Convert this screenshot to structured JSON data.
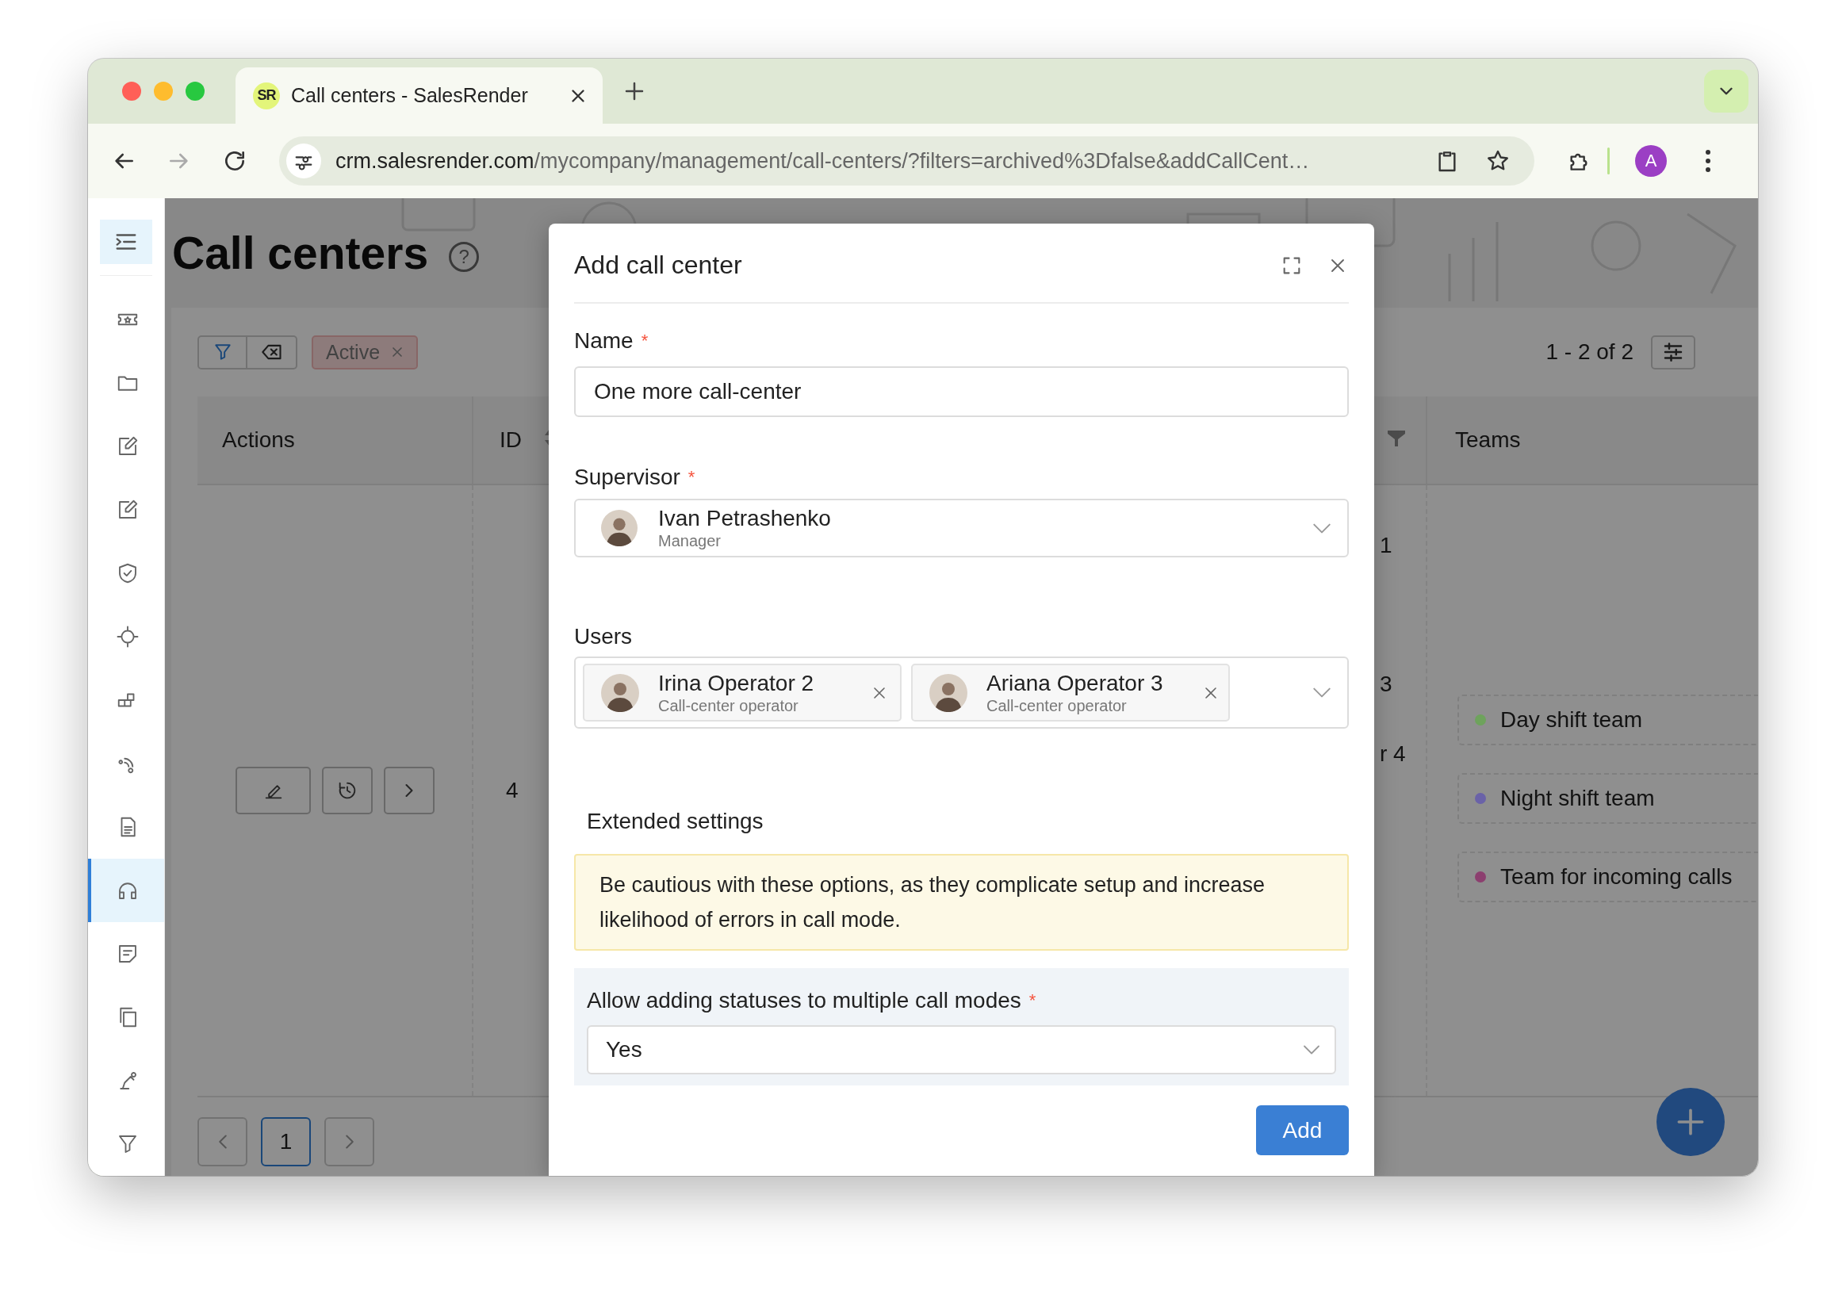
{
  "browser": {
    "tab": {
      "favicon": "SR",
      "title": "Call centers - SalesRender"
    },
    "back": {
      "disabled": false
    },
    "forward": {
      "disabled": true
    },
    "url": {
      "host": "crm.salesrender.com",
      "path": "/mycompany/management/call-centers/?filters=archived%3Dfalse&addCallCent…"
    },
    "profile": "A"
  },
  "sidebar": {
    "items": [
      {
        "selected": false
      },
      {
        "selected": false
      },
      {
        "selected": false
      },
      {
        "selected": false
      },
      {
        "selected": false
      },
      {
        "selected": false
      },
      {
        "selected": false
      },
      {
        "selected": false
      },
      {
        "selected": false
      },
      {
        "selected": true
      },
      {
        "selected": false
      },
      {
        "selected": false
      },
      {
        "selected": false
      },
      {
        "selected": false
      }
    ]
  },
  "page": {
    "title": "Call centers",
    "help": "?",
    "filters": [
      {
        "label": "Active"
      }
    ],
    "range": "1 - 2 of 2",
    "table": {
      "columns": [
        {
          "label": "Actions"
        },
        {
          "label": "ID",
          "sortable": true
        },
        {
          "filterable": true
        },
        {
          "label": "Teams"
        }
      ],
      "rows": [
        {
          "id": "4",
          "column_3": [
            "1",
            "3",
            "r 4"
          ],
          "teams": [
            {
              "name": "Day shift team",
              "color": "#6ea35c"
            },
            {
              "name": "Night shift team",
              "color": "#6a62a8"
            },
            {
              "name": "Team for incoming calls",
              "color": "#8c3f6f"
            }
          ]
        }
      ]
    },
    "pagination": [
      {
        "label": "1",
        "selected": true
      }
    ]
  },
  "modal": {
    "title": "Add call center",
    "name_field": {
      "label": "Name",
      "marker": "*",
      "value": "One more call-center"
    },
    "supervisor_field": {
      "label": "Supervisor",
      "marker": "*",
      "user": {
        "name": "Ivan Petrashenko",
        "role": "Manager"
      }
    },
    "users_field": {
      "label": "Users",
      "users": [
        {
          "name": "Irina Operator 2",
          "role": "Call-center operator"
        },
        {
          "name": "Ariana Operator 3",
          "role": "Call-center operator"
        }
      ]
    },
    "extended_settings": {
      "heading": "Extended settings",
      "warning": "Be cautious with these options, as they complicate setup and increase likelihood of errors in call mode.",
      "field": {
        "label": "Allow adding statuses to multiple call modes",
        "marker": "*",
        "value": "Yes"
      }
    },
    "submit": "Add"
  }
}
